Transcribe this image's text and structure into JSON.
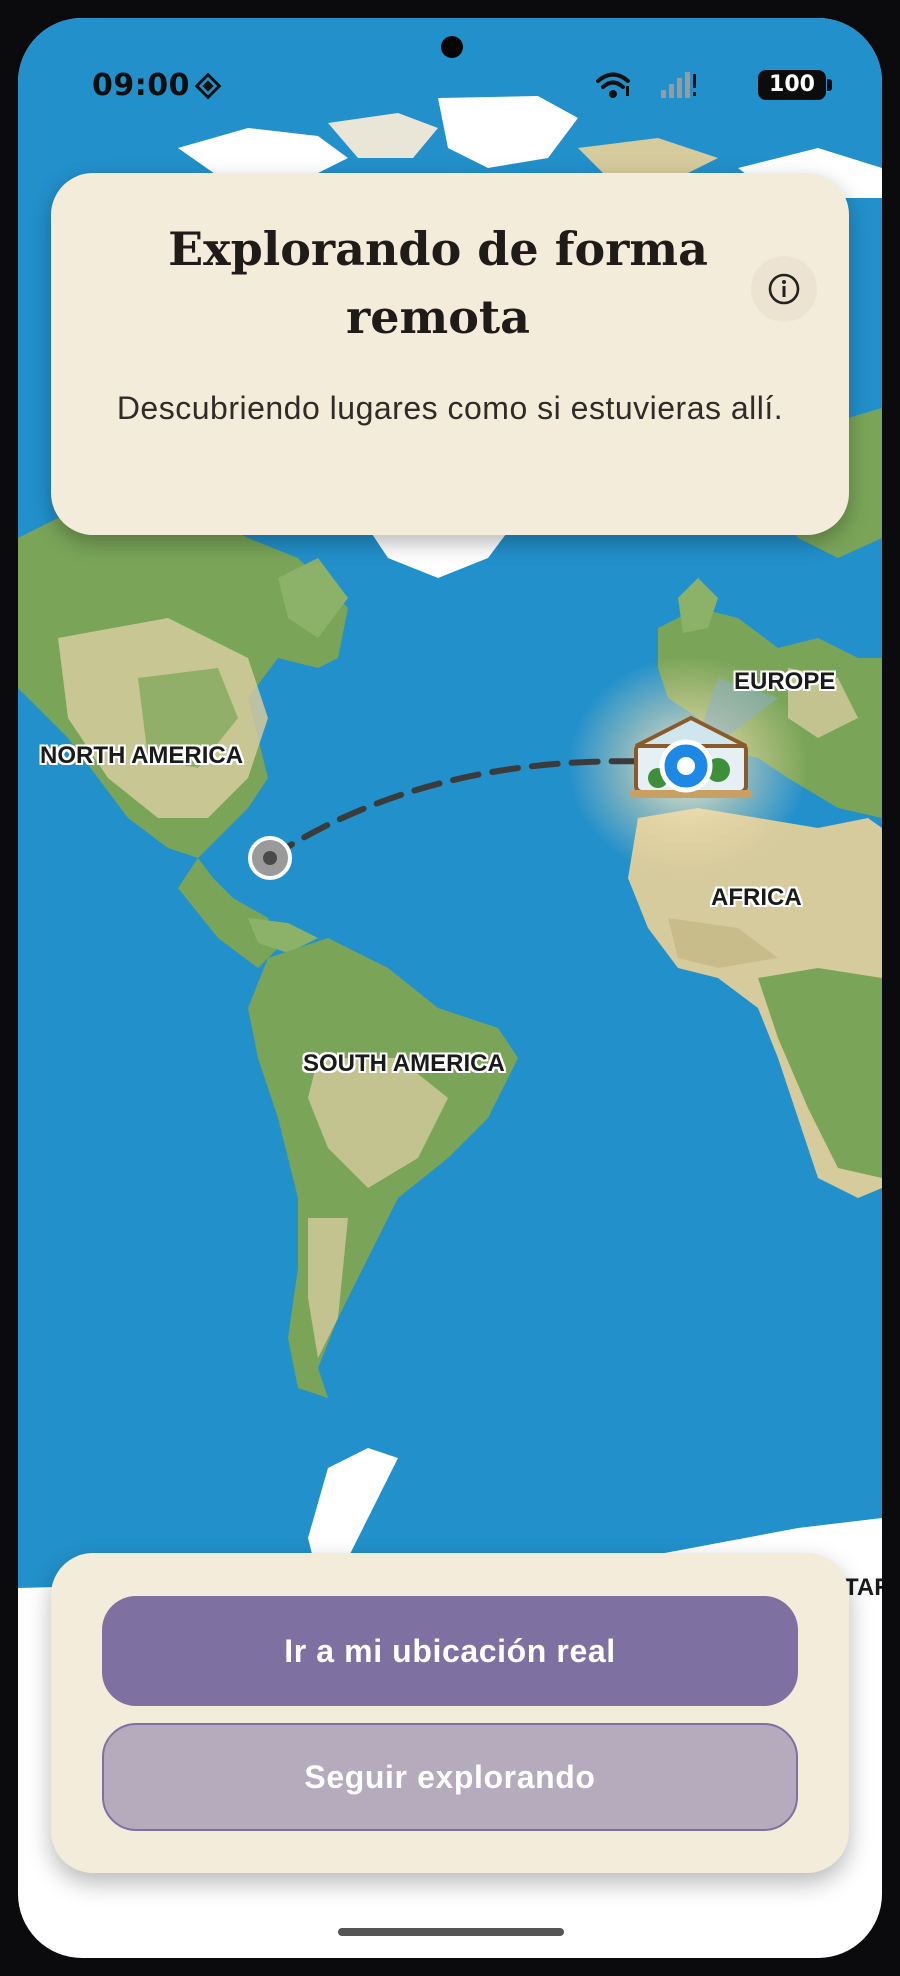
{
  "status_bar": {
    "time": "09:00",
    "battery": "100",
    "icons": [
      "diamond-icon",
      "wifi-icon",
      "signal-icon",
      "battery-icon"
    ]
  },
  "info_card": {
    "title": "Explorando de forma remota",
    "subtitle": "Descubriendo lugares como si estuvieras allí.",
    "info_icon": "info-icon"
  },
  "map": {
    "labels": {
      "north_america": "NORTH AMERICA",
      "europe": "EUROPE",
      "africa": "AFRICA",
      "south_america": "SOUTH AMERICA",
      "antarctica_partial": "TAR"
    },
    "colors": {
      "ocean": "#2290cb",
      "land_green": "#7aa559",
      "land_tan": "#d6cb9c",
      "ice": "#ffffff",
      "route": "#3b3b3b",
      "marker": "#1e88e5"
    },
    "markers": [
      "origin-marker",
      "destination-marker"
    ]
  },
  "actions": {
    "primary": "Ir a mi ubicación real",
    "secondary": "Seguir explorando"
  }
}
